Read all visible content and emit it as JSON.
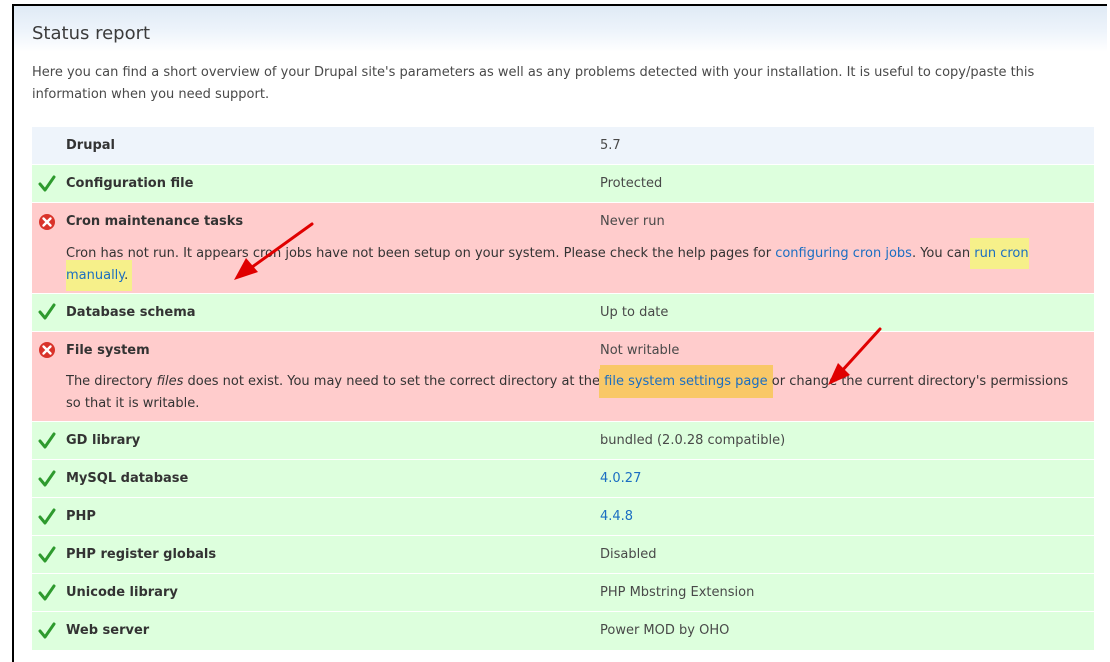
{
  "page": {
    "title": "Status report",
    "intro": "Here you can find a short overview of your Drupal site's parameters as well as any problems detected with your installation. It is useful to copy/paste this information when you need support."
  },
  "rows": {
    "drupal": {
      "label": "Drupal",
      "value": "5.7"
    },
    "config": {
      "label": "Configuration file",
      "value": "Protected",
      "icon": "check-icon"
    },
    "cron": {
      "label": "Cron maintenance tasks",
      "value": "Never run",
      "icon": "error-icon",
      "desc_pre": "Cron has not run. It appears cron jobs have not been setup on your system. Please check the help pages for ",
      "link1": "configuring cron jobs",
      "desc_mid": ". You can ",
      "link2": "run cron manually",
      "desc_post": "."
    },
    "db_schema": {
      "label": "Database schema",
      "value": "Up to date",
      "icon": "check-icon"
    },
    "filesystem": {
      "label": "File system",
      "value": "Not writable",
      "icon": "error-icon",
      "desc_pre": "The directory ",
      "desc_em": "files",
      "desc_mid": " does not exist. You may need to set the correct directory at the ",
      "link": "file system settings page",
      "desc_post": " or change the current directory's permissions so that it is writable."
    },
    "gd": {
      "label": "GD library",
      "value": "bundled (2.0.28 compatible)",
      "icon": "check-icon"
    },
    "mysql": {
      "label": "MySQL database",
      "value": "4.0.27",
      "icon": "check-icon"
    },
    "php": {
      "label": "PHP",
      "value": "4.4.8",
      "icon": "check-icon"
    },
    "register_globals": {
      "label": "PHP register globals",
      "value": "Disabled",
      "icon": "check-icon"
    },
    "unicode": {
      "label": "Unicode library",
      "value": "PHP Mbstring Extension",
      "icon": "check-icon"
    },
    "webserver": {
      "label": "Web server",
      "value": "Power MOD by OHO",
      "icon": "check-icon"
    }
  },
  "colors": {
    "ok_row": "#ddffdd",
    "error_row": "#ffcccc",
    "info_row": "#eef4fb",
    "link": "#1b6ec2",
    "highlight_yellow": "#f6f08a",
    "highlight_orange": "#f9c867",
    "arrow": "#e00000"
  }
}
